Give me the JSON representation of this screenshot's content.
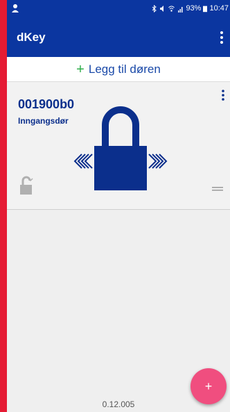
{
  "statusbar": {
    "battery_text": "93%",
    "time": "10:47"
  },
  "appbar": {
    "title": "dKey"
  },
  "add_door": {
    "plus": "+",
    "label": "Legg til døren"
  },
  "door": {
    "id": "001900b0",
    "name": "Inngangsdør",
    "state_icon": "lock-icon"
  },
  "footer": {
    "version": "0.12.005"
  },
  "fab": {
    "label": "+"
  },
  "colors": {
    "primary": "#0b36a0",
    "accent": "#f04e7f",
    "plus_green": "#2eae4a",
    "frame_red": "#e51b34"
  }
}
